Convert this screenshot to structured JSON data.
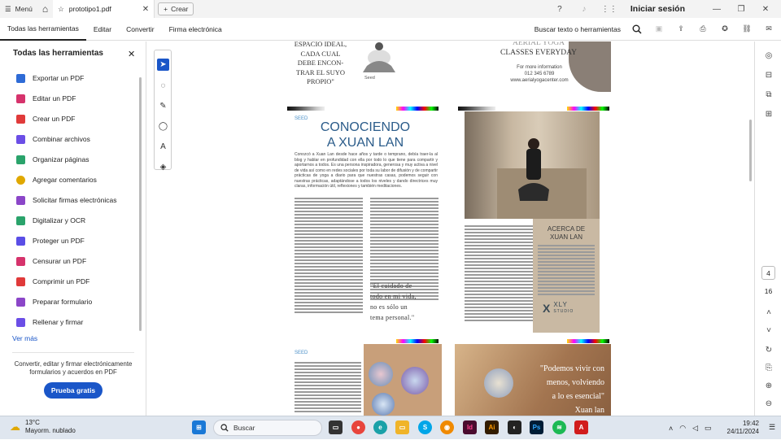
{
  "titlebar": {
    "menu_label": "Menú",
    "tab_title": "prototipo1.pdf",
    "new_tab_label": "Crear",
    "signin_label": "Iniciar sesión"
  },
  "menubar": {
    "items": [
      "Todas las herramientas",
      "Editar",
      "Convertir",
      "Firma electrónica"
    ],
    "search_label": "Buscar texto o herramientas"
  },
  "panel": {
    "title": "Todas las herramientas",
    "tools": [
      {
        "label": "Exportar un PDF",
        "color": "#2e6bd6"
      },
      {
        "label": "Editar un PDF",
        "color": "#d6336c"
      },
      {
        "label": "Crear un PDF",
        "color": "#e03a3a"
      },
      {
        "label": "Combinar archivos",
        "color": "#6b4ee6"
      },
      {
        "label": "Organizar páginas",
        "color": "#2aa36b"
      },
      {
        "label": "Agregar comentarios",
        "color": "#e0a800"
      },
      {
        "label": "Solicitar firmas electrónicas",
        "color": "#8b46c8"
      },
      {
        "label": "Digitalizar y OCR",
        "color": "#2aa36b"
      },
      {
        "label": "Proteger un PDF",
        "color": "#5a4ee6"
      },
      {
        "label": "Censurar un PDF",
        "color": "#d6336c"
      },
      {
        "label": "Comprimir un PDF",
        "color": "#e03a3a"
      },
      {
        "label": "Preparar formulario",
        "color": "#8b46c8"
      },
      {
        "label": "Rellenar y firmar",
        "color": "#6b4ee6"
      }
    ],
    "see_more": "Ver más",
    "promo_text": "Convertir, editar y firmar electrónicamente formularios y acuerdos en PDF",
    "trial_button": "Prueba gratis"
  },
  "document": {
    "top_left_text": [
      "ESPACIO IDEAL,",
      "CADA CUAL",
      "DEBE ENCON-",
      "TRAR EL SUYO",
      "PROPIO\""
    ],
    "top_left_caption": "Seed",
    "top_right_title": [
      "AERIAL YOGA",
      "CLASSES EVERYDAY"
    ],
    "top_right_info": [
      "For more information",
      "012 345 6789",
      "www.aerialyogacenter.com"
    ],
    "seed_label": "SEED",
    "article_title": [
      "CONOCIENDO",
      "A XUAN LAN"
    ],
    "intro_text": "Conozcó a Xuan Lan desde hace años y tarde o temprano, debía traer-la al blog y hablar en profundidad con ella por todo lo que tiene para compartir y aportarnos a todos. Es una persona inspiradora, generosa y muy activa a nivel de vida así como en redes sociales por toda su labor de difusión y de compartir prácticas de yoga a diario para que nuestras casas, podemos seguir con nuestras prácticas, adaptándose a todos los niveles y dando directrices muy claras, información útil, reflexiones y también meditaciones.",
    "pull_quote": [
      "\"El cuidado de",
      "todo en mi vida,",
      "no es sólo un",
      "tema personal.\""
    ],
    "about_title": [
      "ACERCA DE",
      "XUAN LAN"
    ],
    "studio_name": "XLY",
    "studio_sub": "STUDIO",
    "bottom_seed": "SEED",
    "bottom_quote": [
      "\"Podemos vivir con",
      "menos, volviendo",
      "a lo es esencial\"",
      "Xuan lan"
    ]
  },
  "rightbar": {
    "current_page": "4",
    "total_pages": "16"
  },
  "taskbar": {
    "temperature": "13°C",
    "weather": "Mayorm. nublado",
    "search_label": "Buscar",
    "time": "19:42",
    "date": "24/11/2024"
  },
  "colors": {
    "accent": "#1a56c8",
    "title_blue": "#2b5c8a",
    "photo_bg": "#c8b8a2",
    "about_bg": "#c9b9a3"
  }
}
